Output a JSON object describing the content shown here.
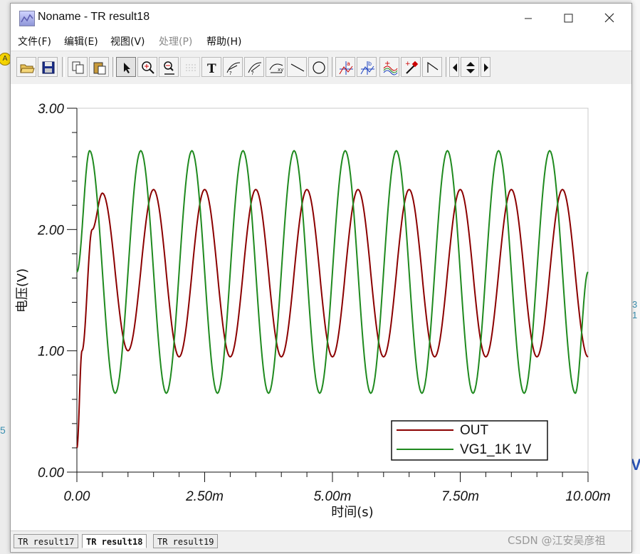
{
  "window": {
    "title": "Noname - TR result18"
  },
  "menu": [
    {
      "label": "文件(F)",
      "enabled": true
    },
    {
      "label": "编辑(E)",
      "enabled": true
    },
    {
      "label": "视图(V)",
      "enabled": true
    },
    {
      "label": "处理(P)",
      "enabled": false
    },
    {
      "label": "帮助(H)",
      "enabled": true
    }
  ],
  "toolbar": [
    "open-folder-icon",
    "save-icon",
    "copy-icon",
    "paste-icon",
    "select-arrow-icon",
    "zoom-in-icon",
    "zoom-100-icon",
    "grid-icon",
    "text-tool-icon",
    "curve-label-icon",
    "curve-label-2-icon",
    "curve-label-3-icon",
    "line-tool-icon",
    "circle-tool-icon",
    "cursor-a-icon",
    "cursor-b-icon",
    "add-curves-icon",
    "probe-icon",
    "bend-line-icon",
    "step-left-icon",
    "step-up-down-icon",
    "step-right-icon"
  ],
  "tabs": [
    "TR result17",
    "TR result18",
    "TR result19"
  ],
  "active_tab": 1,
  "background": {
    "badge": "A",
    "frag_left": "5",
    "frag_right_top": "3 1",
    "frag_right_bottom": "V"
  },
  "watermark": "CSDN @江安吴彦祖",
  "chart_data": {
    "type": "line",
    "xlabel": "时间(s)",
    "ylabel": "电压(V)",
    "xlim": [
      0,
      10
    ],
    "ylim": [
      0,
      3
    ],
    "x_ticks": [
      "0.00",
      "2.50m",
      "5.00m",
      "7.50m",
      "10.00m"
    ],
    "y_ticks": [
      "0.00",
      "1.00",
      "2.00",
      "3.00"
    ],
    "grid": true,
    "legend_position": "bottom-right",
    "series": [
      {
        "name": "OUT",
        "color": "#8b0000",
        "x": [
          0,
          0.1,
          0.3,
          0.5,
          1.0,
          1.5,
          2.0,
          2.5,
          3.0,
          3.5,
          4.0,
          4.5,
          5.0,
          5.5,
          6.0,
          6.5,
          7.0,
          7.5,
          8.0,
          8.5,
          9.0,
          9.5,
          10.0
        ],
        "y": [
          0.2,
          1.0,
          2.0,
          2.3,
          1.0,
          2.33,
          0.95,
          2.33,
          0.95,
          2.33,
          0.95,
          2.33,
          0.95,
          2.33,
          0.95,
          2.33,
          0.95,
          2.33,
          0.95,
          2.33,
          0.95,
          2.33,
          0.95
        ]
      },
      {
        "name": "VG1_1K 1V",
        "color": "#1f8a1f",
        "x": [
          0,
          0.25,
          0.75,
          1.25,
          1.75,
          2.25,
          2.75,
          3.25,
          3.75,
          4.25,
          4.75,
          5.25,
          5.75,
          6.25,
          6.75,
          7.25,
          7.75,
          8.25,
          8.75,
          9.25,
          9.75,
          10.0
        ],
        "y": [
          1.65,
          2.65,
          0.65,
          2.65,
          0.65,
          2.65,
          0.65,
          2.65,
          0.65,
          2.65,
          0.65,
          2.65,
          0.65,
          2.65,
          0.65,
          2.65,
          0.65,
          2.65,
          0.65,
          2.65,
          0.65,
          1.65
        ]
      }
    ]
  }
}
